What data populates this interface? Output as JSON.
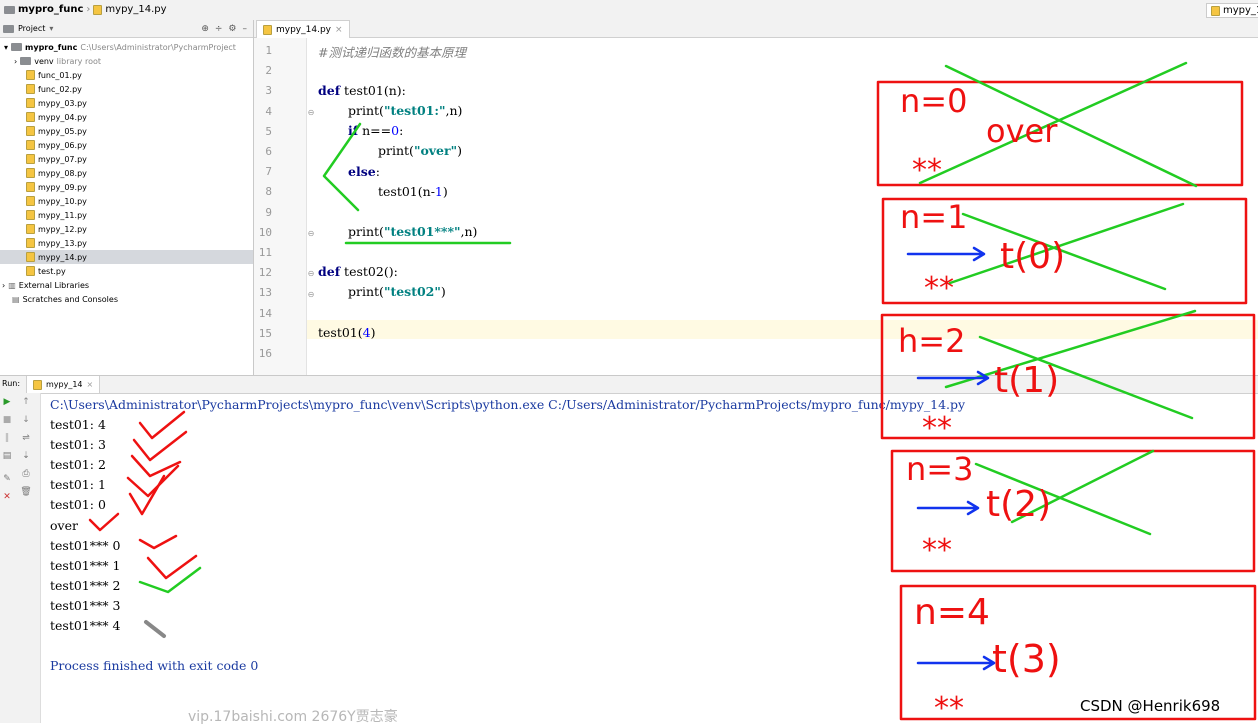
{
  "breadcrumb": {
    "project": "mypro_func",
    "file": "mypy_14.py"
  },
  "topbar_right_tab": "mypy_1",
  "sidebar": {
    "header": "Project",
    "root": {
      "name": "mypro_func",
      "path": "C:\\Users\\Administrator\\PycharmProject"
    },
    "venv": {
      "name": "venv",
      "suffix": "library root"
    },
    "files": [
      "func_01.py",
      "func_02.py",
      "mypy_03.py",
      "mypy_04.py",
      "mypy_05.py",
      "mypy_06.py",
      "mypy_07.py",
      "mypy_08.py",
      "mypy_09.py",
      "mypy_10.py",
      "mypy_11.py",
      "mypy_12.py",
      "mypy_13.py",
      "mypy_14.py",
      "test.py"
    ],
    "selected_file": "mypy_14.py",
    "external": "External Libraries",
    "scratches": "Scratches and Consoles"
  },
  "editor": {
    "tab": "mypy_14.py",
    "line_numbers": [
      "1",
      "2",
      "3",
      "4",
      "5",
      "6",
      "7",
      "8",
      "9",
      "10",
      "11",
      "12",
      "13",
      "14",
      "15",
      "16"
    ],
    "comment": "#测试递归函数的基本原理",
    "l3_def": "def",
    "l3_rest": " test01(n):",
    "l4_fn": "print(",
    "l4_str": "\"test01:\"",
    "l4_rest": ",n)",
    "l5_kw": "if",
    "l5_a": " n==",
    "l5_num": "0",
    "l5_b": ":",
    "l6_fn": "print(",
    "l6_str": "\"over\"",
    "l6_rest": ")",
    "l7_kw": "else",
    ":": ":",
    "l8_a": "test01(n-",
    "l8_num": "1",
    "l8_b": ")",
    "l10_fn": "print(",
    "l10_str": "\"test01***\"",
    "l10_rest": ",n)",
    "l12_def": "def",
    "l12_rest": " test02():",
    "l13_fn": "print(",
    "l13_str": "\"test02\"",
    "l13_rest": ")",
    "l15_a": "test01(",
    "l15_num": "4",
    "l15_b": ")"
  },
  "run": {
    "label": "Run:",
    "tab": "mypy_14",
    "command": "C:\\Users\\Administrator\\PycharmProjects\\mypro_func\\venv\\Scripts\\python.exe C:/Users/Administrator/PycharmProjects/mypro_func/mypy_14.py",
    "output": [
      "test01: 4",
      "test01: 3",
      "test01: 2",
      "test01: 1",
      "test01: 0",
      "over",
      "test01*** 0",
      "test01*** 1",
      "test01*** 2",
      "test01*** 3",
      "test01*** 4"
    ],
    "exit": "Process finished with exit code 0"
  },
  "annotations": {
    "box1": {
      "n": "n=0",
      "word": "over",
      "stars": "**"
    },
    "box2": {
      "n": "n=1",
      "call": "t(0)",
      "stars": "**"
    },
    "box3": {
      "n": "h=2",
      "call": "t(1)",
      "stars": "**"
    },
    "box4": {
      "n": "n=3",
      "call": "t(2)",
      "stars": "**"
    },
    "box5": {
      "n": "n=4",
      "call": "t(3)",
      "stars": "**"
    }
  },
  "watermarks": {
    "left": "vip.17baishi.com 2676Y贾志豪",
    "right": "CSDN @Henrik698"
  },
  "colors": {
    "ink_red": "#ee1111",
    "ink_green": "#22cc22",
    "ink_blue": "#1133ee"
  }
}
